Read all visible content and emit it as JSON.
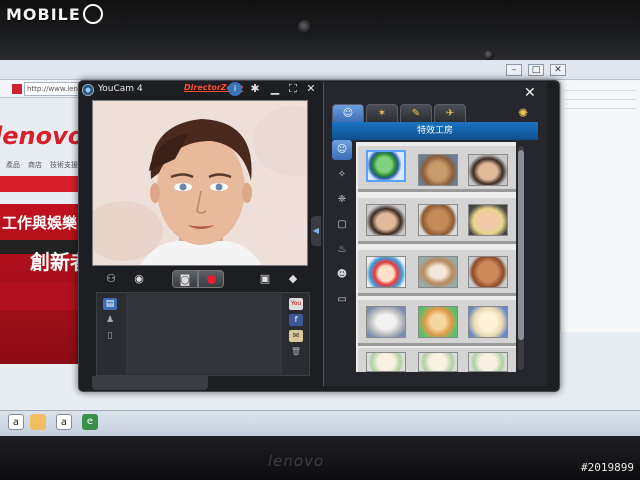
{
  "photo": {
    "watermark": "MOBILE",
    "watermark_icon": "mobile01-logo-icon",
    "photo_id": "#2019899",
    "bezel_brand": "lenovo"
  },
  "browser": {
    "address": "http://www.lenovo",
    "site_logo": "lenovo",
    "nav_items": [
      "產品",
      "商店",
      "技術支援"
    ],
    "banner_line1": "工作與娛樂",
    "banner_line2": "創新者"
  },
  "youcam": {
    "title": "YouCam 4",
    "director_zone": "DirectorZone",
    "toolbar_icons": [
      "info-badge-icon",
      "gear-icon",
      "minimize-icon",
      "fullscreen-icon",
      "close-icon"
    ],
    "controls": [
      "face-tracking-icon",
      "eye-icon",
      "camera-icon",
      "record-icon",
      "picture-icon",
      "eraser-icon"
    ],
    "media_tabs": [
      "media-library-icon",
      "person-icon",
      "file-icon"
    ],
    "share_icons": [
      "youtube-icon",
      "facebook-icon",
      "email-icon",
      "trash-icon"
    ]
  },
  "effects": {
    "tabs": [
      "avatar-tab",
      "sparkle-tab",
      "brush-tab",
      "gadget-tab"
    ],
    "header": "特效工房",
    "categories": [
      "avatar-category",
      "magic-wand-category",
      "particle-category",
      "frame-category",
      "scene-category",
      "emotion-category",
      "border-category"
    ],
    "close_glyph": "✕",
    "rows": [
      [
        "globe-download-avatar",
        "fur-creature-avatar",
        "man-portrait-avatar"
      ],
      [
        "cartoon-man-avatar",
        "teddy-bear-avatar",
        "blond-man-avatar"
      ],
      [
        "clown-avatar",
        "dog-avatar",
        "poodle-avatar"
      ],
      [
        "statue-avatar",
        "lion-avatar",
        "sheep-avatar"
      ],
      [
        "small-avatar-1",
        "small-avatar-2",
        "small-avatar-3"
      ]
    ]
  },
  "taskbar": {
    "items": [
      "search-box",
      "folder-icon",
      "calendar-icon",
      "browser-icon"
    ]
  }
}
